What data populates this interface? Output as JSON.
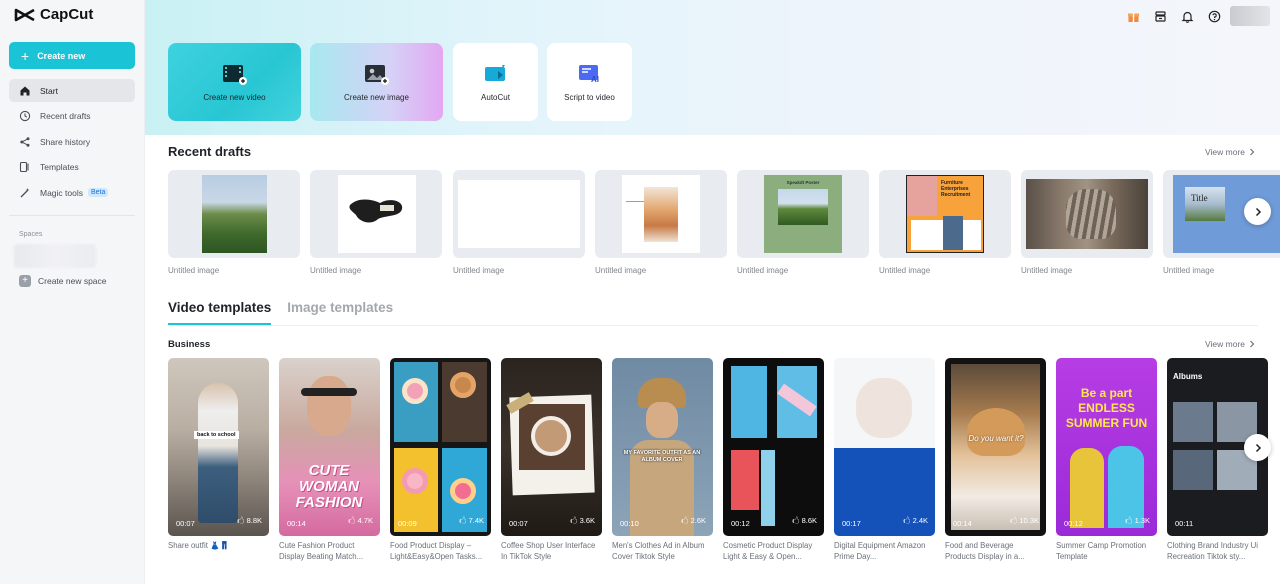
{
  "app": {
    "logo_text": "CapCut"
  },
  "sidebar": {
    "create_label": "Create new",
    "items": [
      {
        "label": "Start"
      },
      {
        "label": "Recent drafts"
      },
      {
        "label": "Share history"
      },
      {
        "label": "Templates"
      },
      {
        "label": "Magic tools",
        "badge": "Beta"
      }
    ],
    "spaces_label": "Spaces",
    "create_space_label": "Create new space"
  },
  "quick_actions": [
    {
      "label": "Create new video"
    },
    {
      "label": "Create new image"
    },
    {
      "label": "AutoCut"
    },
    {
      "label": "Script to video"
    }
  ],
  "recent_drafts": {
    "title": "Recent drafts",
    "view_more": "View more",
    "items": [
      {
        "label": "Untitled image"
      },
      {
        "label": "Untitled image"
      },
      {
        "label": "Untitled image"
      },
      {
        "label": "Untitled image"
      },
      {
        "label": "Untitled image",
        "caption": "Speakdt Poster"
      },
      {
        "label": "Untitled image",
        "caption": "Furniture Enterprises Recruitment"
      },
      {
        "label": "Untitled image"
      },
      {
        "label": "Untitled image",
        "caption": "Title"
      }
    ]
  },
  "tabs": [
    {
      "label": "Video templates"
    },
    {
      "label": "Image templates"
    }
  ],
  "business": {
    "title": "Business",
    "view_more": "View more",
    "templates": [
      {
        "title": "Share outfit 👗👖",
        "duration": "00:07",
        "likes": "8.8K",
        "overlay": "back to school"
      },
      {
        "title": "Cute Fashion Product Display Beating Match...",
        "duration": "00:14",
        "likes": "4.7K",
        "overlay": "CUTE WOMAN FASHION"
      },
      {
        "title": "Food Product Display – Light&Easy&Open Tasks...",
        "duration": "00:09",
        "likes": "7.4K",
        "overlay": ""
      },
      {
        "title": "Coffee Shop User Interface In TikTok Style",
        "duration": "00:07",
        "likes": "3.6K",
        "overlay": ""
      },
      {
        "title": "Men's Clothes Ad in Album Cover Tiktok Style",
        "duration": "00:10",
        "likes": "2.6K",
        "overlay": "MY FAVORITE OUTFIT AS AN ALBUM COVER"
      },
      {
        "title": "Cosmetic Product Display Light & Easy & Open...",
        "duration": "00:12",
        "likes": "8.6K",
        "overlay": ""
      },
      {
        "title": "Digital Equipment Amazon Prime Day...",
        "duration": "00:17",
        "likes": "2.4K",
        "overlay": ""
      },
      {
        "title": "Food and Beverage Products Display in a...",
        "duration": "00:14",
        "likes": "10.3K",
        "overlay": "Do you want it?"
      },
      {
        "title": "Summer Camp Promotion Template",
        "duration": "00:12",
        "likes": "1.3K",
        "overlay": "Be a part ENDLESS SUMMER FUN"
      },
      {
        "title": "Clothing Brand Industry Ui Recreation Tiktok sty...",
        "duration": "00:11",
        "likes": "",
        "overlay": "Albums"
      }
    ]
  },
  "colors": {
    "accent": "#1ac3d6",
    "sidebar_bg": "#f5f6f8"
  }
}
